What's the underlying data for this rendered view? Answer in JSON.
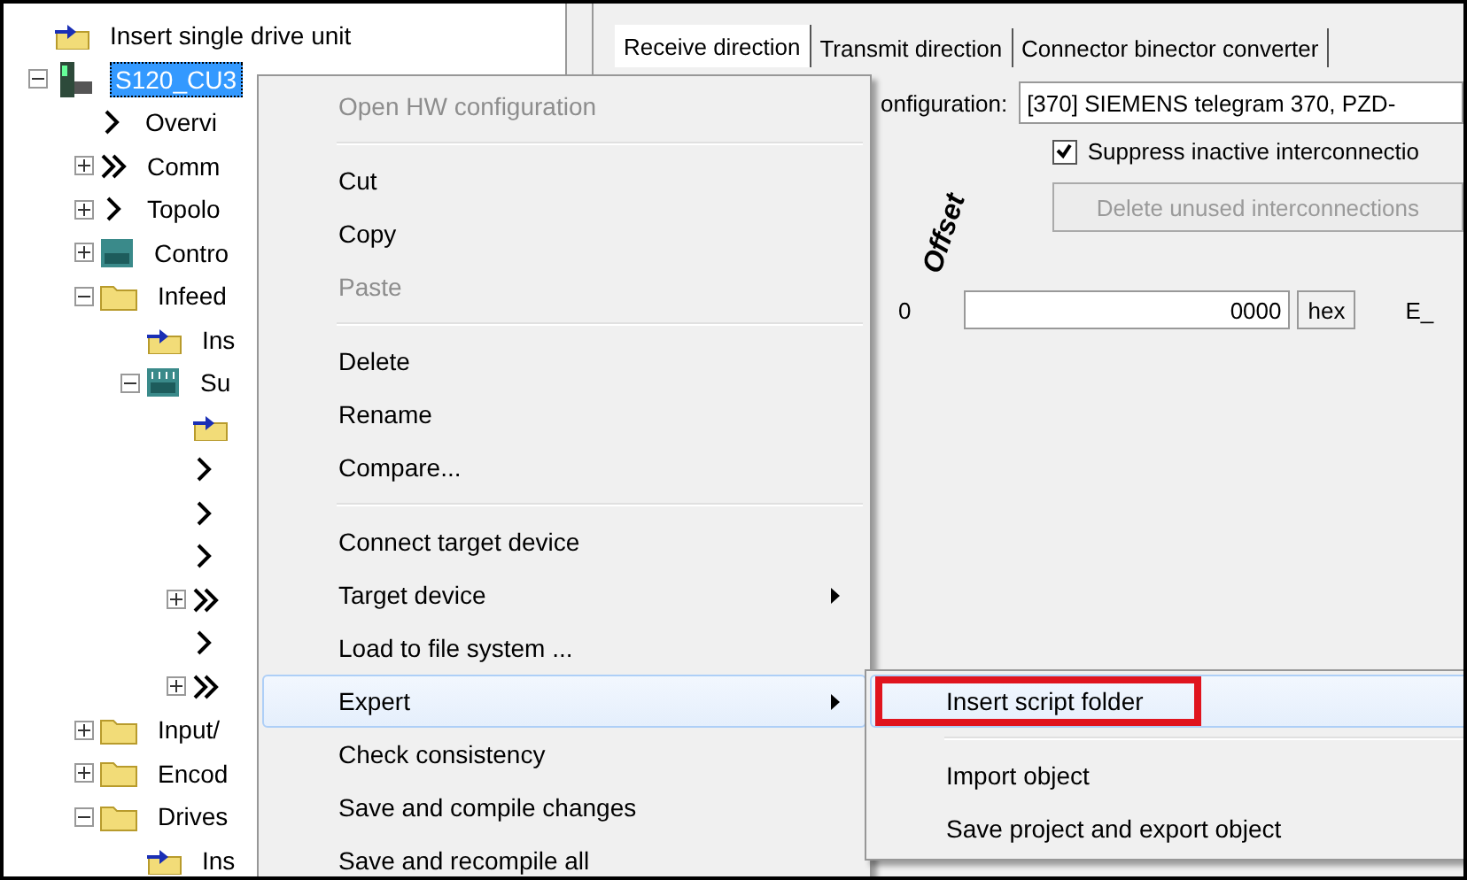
{
  "tree": [
    {
      "label": "Insert single drive unit",
      "kind": "insert"
    },
    {
      "label": "S120_CU3",
      "kind": "device",
      "selected": true,
      "expanded": true,
      "children": [
        {
          "label": "Overvi",
          "kind": "single"
        },
        {
          "label": "Comm",
          "kind": "double",
          "expanded": false
        },
        {
          "label": "Topolo",
          "kind": "single",
          "expanded": false
        },
        {
          "label": "Contro",
          "kind": "cu",
          "expanded": false
        },
        {
          "label": "Infeed",
          "kind": "folder",
          "expanded": true,
          "children": [
            {
              "label": "Ins",
              "kind": "insert"
            },
            {
              "label": "Su",
              "kind": "lm",
              "expanded": true,
              "children": [
                {
                  "kind": "insert"
                },
                {
                  "kind": "single"
                },
                {
                  "kind": "single"
                },
                {
                  "kind": "single"
                },
                {
                  "kind": "double",
                  "expanded": false
                },
                {
                  "kind": "single"
                },
                {
                  "kind": "double",
                  "expanded": false
                }
              ]
            }
          ]
        },
        {
          "label": "Input/",
          "kind": "folder",
          "expanded": false
        },
        {
          "label": "Encod",
          "kind": "folder",
          "expanded": false
        },
        {
          "label": "Drives",
          "kind": "folder",
          "expanded": true,
          "children": [
            {
              "label": "Ins",
              "kind": "insert"
            }
          ]
        }
      ]
    }
  ],
  "tabs": [
    {
      "label": "Receive direction",
      "selected": true
    },
    {
      "label": "Transmit direction",
      "selected": false
    },
    {
      "label": "Connector binector converter",
      "selected": false
    }
  ],
  "configuration": {
    "label": "onfiguration:",
    "value": "[370] SIEMENS telegram 370, PZD-"
  },
  "suppress": {
    "label": "Suppress inactive interconnectio",
    "checked": true
  },
  "delete_button": {
    "label": "Delete unused interconnections",
    "disabled": true
  },
  "column_header": "Offset",
  "row": {
    "index": "0",
    "value": "0000",
    "unit": "hex",
    "column_4": "E_"
  },
  "context_menu": [
    {
      "kind": "item",
      "label": "Open HW configuration",
      "disabled": true,
      "selected": false
    },
    {
      "kind": "separator"
    },
    {
      "kind": "item",
      "label": "Cut",
      "disabled": false,
      "selected": false
    },
    {
      "kind": "item",
      "label": "Copy",
      "disabled": false,
      "selected": false
    },
    {
      "kind": "item",
      "label": "Paste",
      "disabled": true,
      "selected": false
    },
    {
      "kind": "separator"
    },
    {
      "kind": "item",
      "label": "Delete",
      "disabled": false,
      "selected": false
    },
    {
      "kind": "item",
      "label": "Rename",
      "disabled": false,
      "selected": false
    },
    {
      "kind": "item",
      "label": "Compare...",
      "disabled": false,
      "selected": false
    },
    {
      "kind": "separator"
    },
    {
      "kind": "item",
      "label": "Connect target device",
      "disabled": false,
      "selected": false
    },
    {
      "kind": "submenu",
      "label": "Target device",
      "disabled": false,
      "selected": false
    },
    {
      "kind": "item",
      "label": "Load to file system ...",
      "disabled": false,
      "selected": false
    },
    {
      "kind": "submenu",
      "label": "Expert",
      "disabled": false,
      "selected": true
    },
    {
      "kind": "item",
      "label": "Check consistency",
      "disabled": false,
      "selected": false
    },
    {
      "kind": "item",
      "label": "Save and compile changes",
      "disabled": false,
      "selected": false
    },
    {
      "kind": "item",
      "label": "Save and recompile all",
      "disabled": false,
      "selected": false
    }
  ],
  "submenu": [
    {
      "kind": "item",
      "label": "Insert script folder",
      "selected": true,
      "marked": true
    },
    {
      "kind": "separator"
    },
    {
      "kind": "item",
      "label": "Import object",
      "selected": false,
      "marked": false
    },
    {
      "kind": "item",
      "label": "Save project and export object",
      "selected": false,
      "marked": false
    }
  ]
}
